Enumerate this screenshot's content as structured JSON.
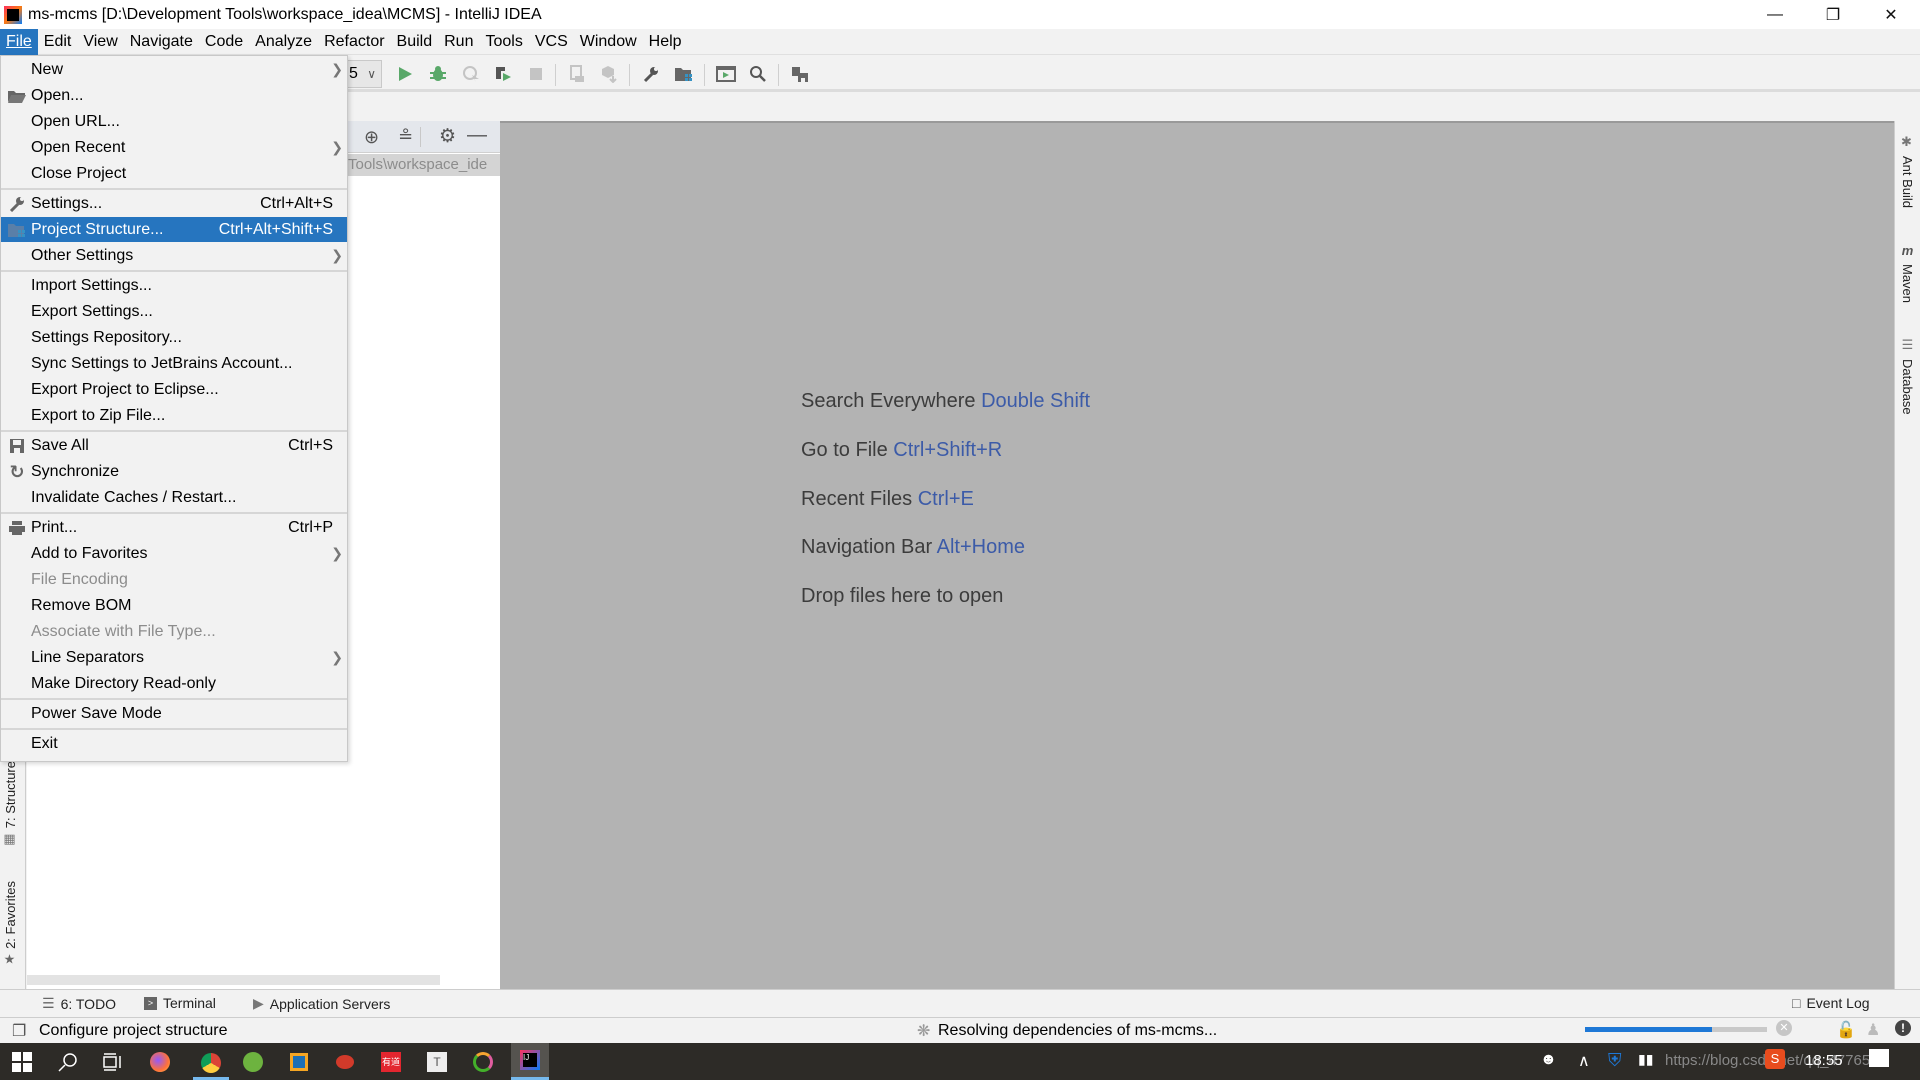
{
  "window": {
    "title": "ms-mcms [D:\\Development Tools\\workspace_idea\\MCMS] - IntelliJ IDEA",
    "minimize_icon": "minimize-icon",
    "restore_icon": "restore-icon",
    "close_icon": "close-icon"
  },
  "menubar": {
    "items": [
      {
        "label": "File",
        "active": true
      },
      {
        "label": "Edit"
      },
      {
        "label": "View"
      },
      {
        "label": "Navigate"
      },
      {
        "label": "Code"
      },
      {
        "label": "Analyze"
      },
      {
        "label": "Refactor"
      },
      {
        "label": "Build"
      },
      {
        "label": "Run"
      },
      {
        "label": "Tools"
      },
      {
        "label": "VCS"
      },
      {
        "label": "Window"
      },
      {
        "label": "Help"
      }
    ]
  },
  "toolbar": {
    "run_config_value": "5",
    "icons": [
      "run-icon",
      "debug-icon",
      "profile-icon",
      "coverage-icon",
      "stop-icon",
      "device-icon",
      "sdk-icon",
      "settings-wrench-icon",
      "project-structure-icon",
      "run-anything-icon",
      "search-icon",
      "database-changes-icon"
    ]
  },
  "file_menu": {
    "items": [
      {
        "label": "New",
        "submenu": true
      },
      {
        "label": "Open...",
        "icon": "folder-open-icon"
      },
      {
        "label": "Open URL..."
      },
      {
        "label": "Open Recent",
        "submenu": true
      },
      {
        "label": "Close Project"
      },
      {
        "separator": true
      },
      {
        "label": "Settings...",
        "shortcut": "Ctrl+Alt+S",
        "icon": "wrench-icon"
      },
      {
        "label": "Project Structure...",
        "shortcut": "Ctrl+Alt+Shift+S",
        "icon": "project-structure-icon",
        "selected": true
      },
      {
        "label": "Other Settings",
        "submenu": true
      },
      {
        "separator": true
      },
      {
        "label": "Import Settings..."
      },
      {
        "label": "Export Settings..."
      },
      {
        "label": "Settings Repository..."
      },
      {
        "label": "Sync Settings to JetBrains Account..."
      },
      {
        "label": "Export Project to Eclipse..."
      },
      {
        "label": "Export to Zip File..."
      },
      {
        "separator": true
      },
      {
        "label": "Save All",
        "shortcut": "Ctrl+S",
        "icon": "save-icon"
      },
      {
        "label": "Synchronize",
        "icon": "sync-icon"
      },
      {
        "label": "Invalidate Caches / Restart..."
      },
      {
        "separator": true
      },
      {
        "label": "Print...",
        "shortcut": "Ctrl+P",
        "icon": "print-icon"
      },
      {
        "label": "Add to Favorites",
        "submenu": true
      },
      {
        "label": "File Encoding",
        "disabled": true
      },
      {
        "label": "Remove BOM"
      },
      {
        "label": "Associate with File Type...",
        "disabled": true
      },
      {
        "label": "Line Separators",
        "submenu": true
      },
      {
        "label": "Make Directory Read-only"
      },
      {
        "separator": true
      },
      {
        "label": "Power Save Mode"
      },
      {
        "separator": true
      },
      {
        "label": "Exit"
      }
    ]
  },
  "project_panel": {
    "path_fragment": "Tools\\workspace_ide"
  },
  "left_stripe": {
    "tabs": [
      "7: Structure",
      "2: Favorites"
    ]
  },
  "right_stripe": {
    "tabs": [
      "Ant Build",
      "Maven",
      "Database"
    ]
  },
  "editor": {
    "hints": [
      {
        "text": "Search Everywhere",
        "key": "Double Shift"
      },
      {
        "text": "Go to File",
        "key": "Ctrl+Shift+R"
      },
      {
        "text": "Recent Files",
        "key": "Ctrl+E"
      },
      {
        "text": "Navigation Bar",
        "key": "Alt+Home"
      },
      {
        "text": "Drop files here to open",
        "key": ""
      }
    ]
  },
  "bottom_tabs": [
    {
      "label": "6: TODO"
    },
    {
      "label": "Terminal"
    },
    {
      "label": "Application Servers"
    }
  ],
  "event_log_label": "Event Log",
  "statusbar": {
    "message": "Configure project structure",
    "task": "Resolving dependencies of ms-mcms...",
    "progress_percent": 70
  },
  "taskbar": {
    "time": "18:55",
    "watermark": "https://blog.csdn.net/qq_4776542",
    "apps": [
      "start-icon",
      "search-icon",
      "task-view-icon",
      "firefox-icon",
      "chrome-icon",
      "spring-icon",
      "virtualbox-icon",
      "app-red-icon",
      "youdao-icon",
      "typora-icon",
      "anaconda-icon",
      "intellij-icon"
    ]
  },
  "colors": {
    "accent": "#2675bf",
    "editor_bg": "#b3b3b3",
    "hint_key": "#3c5ba8",
    "run_green": "#59a869",
    "taskbar_bg": "#2d2b27"
  }
}
